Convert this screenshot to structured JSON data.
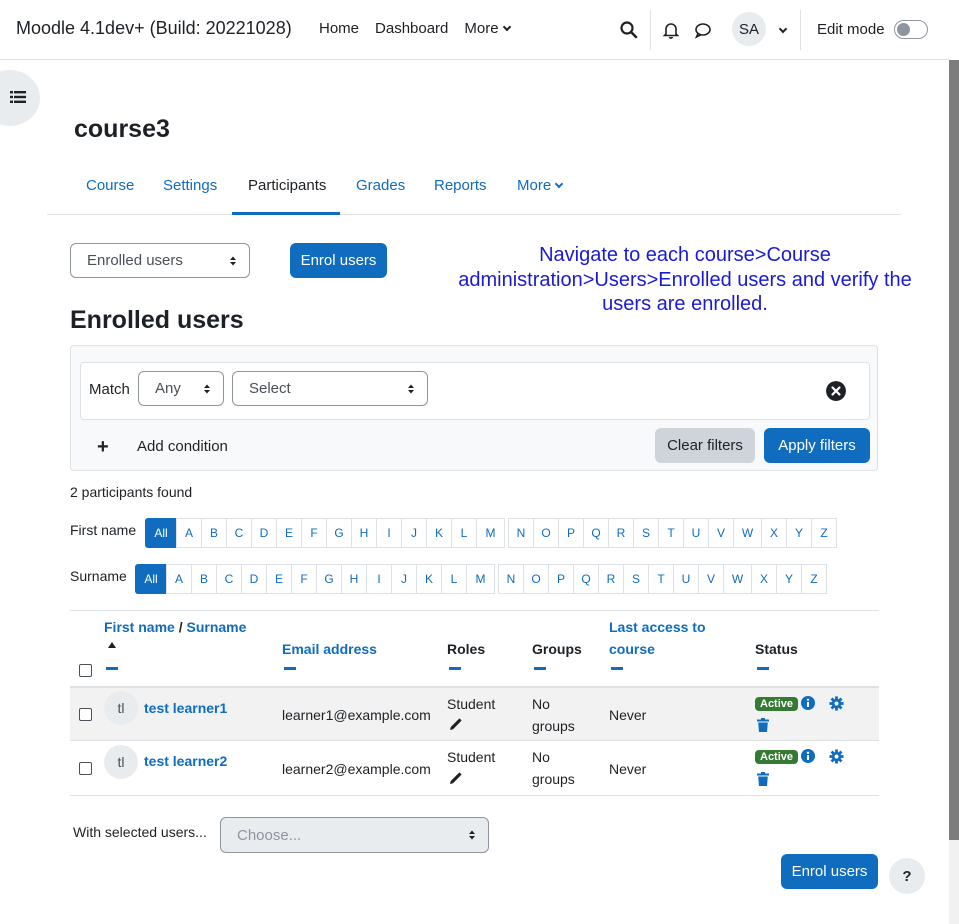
{
  "navbar": {
    "brand": "Moodle 4.1dev+ (Build: 20221028)",
    "links": [
      "Home",
      "Dashboard",
      "More"
    ],
    "avatar_initials": "SA",
    "edit_mode_label": "Edit mode"
  },
  "course": {
    "title": "course3",
    "tabs": [
      "Course",
      "Settings",
      "Participants",
      "Grades",
      "Reports",
      "More"
    ],
    "active_tab": "Participants"
  },
  "controls": {
    "enrolment_select": "Enrolled users",
    "enrol_button": "Enrol users"
  },
  "annotation": "Navigate to each course>Course administration>Users>Enrolled users and verify the users are enrolled.",
  "heading": "Enrolled users",
  "filter": {
    "match_label": "Match",
    "match_value": "Any",
    "select_value": "Select",
    "add_condition": "Add condition",
    "clear_button": "Clear filters",
    "apply_button": "Apply filters"
  },
  "participants_found": "2 participants found",
  "initials": {
    "first_name_label": "First name",
    "surname_label": "Surname",
    "all": "All",
    "letters": [
      "A",
      "B",
      "C",
      "D",
      "E",
      "F",
      "G",
      "H",
      "I",
      "J",
      "K",
      "L",
      "M",
      "N",
      "O",
      "P",
      "Q",
      "R",
      "S",
      "T",
      "U",
      "V",
      "W",
      "X",
      "Y",
      "Z"
    ]
  },
  "table": {
    "headers": {
      "first_name": "First name",
      "separator": "/",
      "surname": "Surname",
      "email": "Email address",
      "roles": "Roles",
      "groups": "Groups",
      "last_access_1": "Last access to",
      "last_access_2": "course",
      "status": "Status"
    },
    "rows": [
      {
        "initials": "tl",
        "name": "test learner1",
        "email": "learner1@example.com",
        "role": "Student",
        "groups_1": "No",
        "groups_2": "groups",
        "last_access": "Never",
        "status": "Active"
      },
      {
        "initials": "tl",
        "name": "test learner2",
        "email": "learner2@example.com",
        "role": "Student",
        "groups_1": "No",
        "groups_2": "groups",
        "last_access": "Never",
        "status": "Active"
      }
    ]
  },
  "bulk": {
    "label": "With selected users...",
    "placeholder": "Choose..."
  },
  "footer": {
    "enrol_button": "Enrol users",
    "help": "?"
  },
  "colors": {
    "primary": "#0f6cbf",
    "active_badge": "#357a32",
    "annotation": "#1a1ad6"
  }
}
